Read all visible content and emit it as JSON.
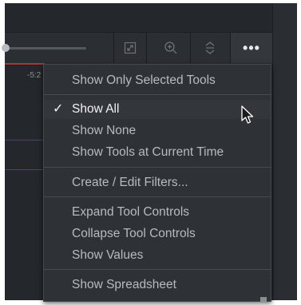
{
  "timeline": {
    "time_label": "-5:2"
  },
  "toolbar": {
    "buttons": [
      {
        "icon": "fit-view-icon"
      },
      {
        "icon": "zoom-in-icon"
      },
      {
        "icon": "expand-collapse-icon"
      },
      {
        "icon": "more-options-icon",
        "label": "•••"
      }
    ]
  },
  "menu": {
    "items": [
      {
        "label": "Show Only Selected Tools",
        "checked": false
      },
      {
        "label": "Show All",
        "checked": true,
        "check_glyph": "✓"
      },
      {
        "label": "Show None",
        "checked": false
      },
      {
        "label": "Show Tools at Current Time",
        "checked": false
      },
      {
        "label": "Create / Edit Filters...",
        "checked": false
      },
      {
        "label": "Expand Tool Controls",
        "checked": false
      },
      {
        "label": "Collapse Tool Controls",
        "checked": false
      },
      {
        "label": "Show Values",
        "checked": false
      },
      {
        "label": "Show Spreadsheet",
        "checked": false
      }
    ]
  },
  "colors": {
    "panel": "#24272b",
    "menu_bg": "#2e3135",
    "menu_text": "#b7bbc0",
    "active_text": "#f2f3f4",
    "timeline_red": "#a23a3a"
  }
}
